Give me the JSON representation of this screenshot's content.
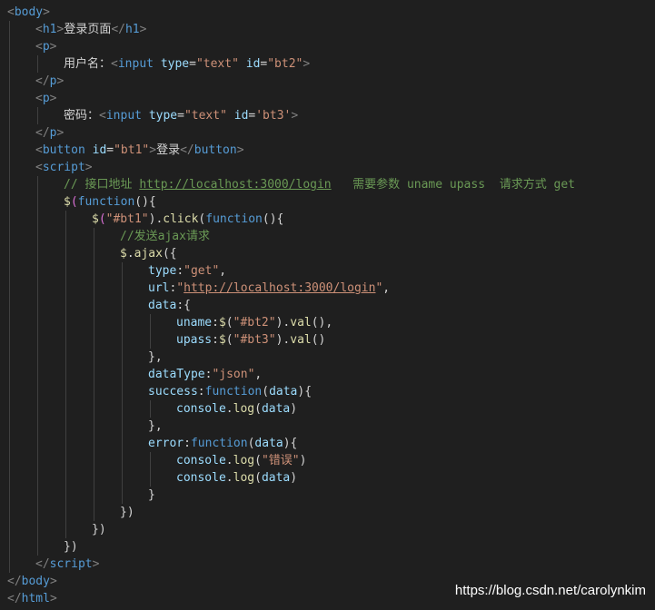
{
  "colors": {
    "background": "#1f1f1f",
    "tag_bracket": "#808080",
    "tag_name": "#569cd6",
    "attribute": "#9cdcfe",
    "string": "#ce9178",
    "comment": "#6a9955",
    "function": "#dcdcaa",
    "text": "#d4d4d4"
  },
  "lines": [
    {
      "indent": 0,
      "tokens": [
        [
          "&lt;",
          "gray"
        ],
        [
          "body",
          "tag"
        ],
        [
          "&gt;",
          "gray"
        ]
      ]
    },
    {
      "indent": 1,
      "tokens": [
        [
          "<",
          "gray"
        ],
        [
          "h1",
          "tag"
        ],
        [
          ">",
          "gray"
        ],
        [
          "登录页面",
          "text"
        ],
        [
          "</",
          "gray"
        ],
        [
          "h1",
          "tag"
        ],
        [
          ">",
          "gray"
        ]
      ]
    },
    {
      "indent": 1,
      "tokens": [
        [
          "<",
          "gray"
        ],
        [
          "p",
          "tag"
        ],
        [
          ">",
          "gray"
        ]
      ]
    },
    {
      "indent": 2,
      "tokens": [
        [
          "用户名：",
          "text"
        ],
        [
          "<",
          "gray"
        ],
        [
          "input",
          "tag"
        ],
        [
          " ",
          "text"
        ],
        [
          "type",
          "attr"
        ],
        [
          "=",
          "text"
        ],
        [
          "\"text\"",
          "str"
        ],
        [
          " ",
          "text"
        ],
        [
          "id",
          "attr"
        ],
        [
          "=",
          "text"
        ],
        [
          "\"bt2\"",
          "str"
        ],
        [
          ">",
          "gray"
        ]
      ]
    },
    {
      "indent": 1,
      "tokens": [
        [
          "</",
          "gray"
        ],
        [
          "p",
          "tag"
        ],
        [
          ">",
          "gray"
        ]
      ]
    },
    {
      "indent": 1,
      "tokens": [
        [
          "<",
          "gray"
        ],
        [
          "p",
          "tag"
        ],
        [
          ">",
          "gray"
        ]
      ]
    },
    {
      "indent": 2,
      "tokens": [
        [
          "密码：",
          "text"
        ],
        [
          "<",
          "gray"
        ],
        [
          "input",
          "tag"
        ],
        [
          " ",
          "text"
        ],
        [
          "type",
          "attr"
        ],
        [
          "=",
          "text"
        ],
        [
          "\"text\"",
          "str"
        ],
        [
          " ",
          "text"
        ],
        [
          "id",
          "attr"
        ],
        [
          "=",
          "text"
        ],
        [
          "'bt3'",
          "str"
        ],
        [
          ">",
          "gray"
        ]
      ]
    },
    {
      "indent": 1,
      "tokens": [
        [
          "</",
          "gray"
        ],
        [
          "p",
          "tag"
        ],
        [
          ">",
          "gray"
        ]
      ]
    },
    {
      "indent": 1,
      "tokens": [
        [
          "<",
          "gray"
        ],
        [
          "button",
          "tag"
        ],
        [
          " ",
          "text"
        ],
        [
          "id",
          "attr"
        ],
        [
          "=",
          "text"
        ],
        [
          "\"bt1\"",
          "str"
        ],
        [
          ">",
          "gray"
        ],
        [
          "登录",
          "text"
        ],
        [
          "</",
          "gray"
        ],
        [
          "button",
          "tag"
        ],
        [
          ">",
          "gray"
        ]
      ]
    },
    {
      "indent": 1,
      "tokens": [
        [
          "<",
          "gray"
        ],
        [
          "script",
          "tag"
        ],
        [
          ">",
          "gray"
        ]
      ]
    },
    {
      "indent": 2,
      "tokens": [
        [
          "// 接口地址 ",
          "comment"
        ],
        [
          "http://localhost:3000/login",
          "link"
        ],
        [
          "   需要参数 uname upass  请求方式 get",
          "comment"
        ]
      ]
    },
    {
      "indent": 2,
      "tokens": [
        [
          "$",
          "ident"
        ],
        [
          "(",
          "paren"
        ],
        [
          "function",
          "kw"
        ],
        [
          "(){",
          "punct"
        ]
      ]
    },
    {
      "indent": 3,
      "tokens": [
        [
          "$",
          "ident"
        ],
        [
          "(",
          "paren"
        ],
        [
          "\"#bt1\"",
          "str"
        ],
        [
          ").",
          "punct"
        ],
        [
          "click",
          "fn"
        ],
        [
          "(",
          "punct"
        ],
        [
          "function",
          "kw"
        ],
        [
          "(){",
          "punct"
        ]
      ]
    },
    {
      "indent": 4,
      "tokens": [
        [
          "//发送ajax请求",
          "comment"
        ]
      ]
    },
    {
      "indent": 4,
      "tokens": [
        [
          "$",
          "ident"
        ],
        [
          ".",
          "punct"
        ],
        [
          "ajax",
          "fn"
        ],
        [
          "({",
          "punct"
        ]
      ]
    },
    {
      "indent": 5,
      "tokens": [
        [
          "type",
          "var"
        ],
        [
          ":",
          "punct"
        ],
        [
          "\"get\"",
          "str"
        ],
        [
          ",",
          "punct"
        ]
      ]
    },
    {
      "indent": 5,
      "tokens": [
        [
          "url",
          "var"
        ],
        [
          ":",
          "punct"
        ],
        [
          "\"",
          "str"
        ],
        [
          "http://localhost:3000/login",
          "strlink"
        ],
        [
          "\"",
          "str"
        ],
        [
          ",",
          "punct"
        ]
      ]
    },
    {
      "indent": 5,
      "tokens": [
        [
          "data",
          "var"
        ],
        [
          ":{",
          "punct"
        ]
      ]
    },
    {
      "indent": 6,
      "tokens": [
        [
          "uname",
          "var"
        ],
        [
          ":",
          "punct"
        ],
        [
          "$",
          "ident"
        ],
        [
          "(",
          "punct"
        ],
        [
          "\"#bt2\"",
          "str"
        ],
        [
          ").",
          "punct"
        ],
        [
          "val",
          "fn"
        ],
        [
          "(),",
          "punct"
        ]
      ]
    },
    {
      "indent": 6,
      "tokens": [
        [
          "upass",
          "var"
        ],
        [
          ":",
          "punct"
        ],
        [
          "$",
          "ident"
        ],
        [
          "(",
          "punct"
        ],
        [
          "\"#bt3\"",
          "str"
        ],
        [
          ").",
          "punct"
        ],
        [
          "val",
          "fn"
        ],
        [
          "()",
          "punct"
        ]
      ]
    },
    {
      "indent": 5,
      "tokens": [
        [
          "},",
          "punct"
        ]
      ]
    },
    {
      "indent": 5,
      "tokens": [
        [
          "dataType",
          "var"
        ],
        [
          ":",
          "punct"
        ],
        [
          "\"json\"",
          "str"
        ],
        [
          ",",
          "punct"
        ]
      ]
    },
    {
      "indent": 5,
      "tokens": [
        [
          "success",
          "var"
        ],
        [
          ":",
          "punct"
        ],
        [
          "function",
          "kw"
        ],
        [
          "(",
          "punct"
        ],
        [
          "data",
          "var"
        ],
        [
          "){",
          "punct"
        ]
      ]
    },
    {
      "indent": 6,
      "tokens": [
        [
          "console",
          "var"
        ],
        [
          ".",
          "punct"
        ],
        [
          "log",
          "fn"
        ],
        [
          "(",
          "punct"
        ],
        [
          "data",
          "var"
        ],
        [
          ")",
          "punct"
        ]
      ]
    },
    {
      "indent": 5,
      "tokens": [
        [
          "},",
          "punct"
        ]
      ]
    },
    {
      "indent": 5,
      "tokens": [
        [
          "error",
          "var"
        ],
        [
          ":",
          "punct"
        ],
        [
          "function",
          "kw"
        ],
        [
          "(",
          "punct"
        ],
        [
          "data",
          "var"
        ],
        [
          "){",
          "punct"
        ]
      ]
    },
    {
      "indent": 6,
      "tokens": [
        [
          "console",
          "var"
        ],
        [
          ".",
          "punct"
        ],
        [
          "log",
          "fn"
        ],
        [
          "(",
          "punct"
        ],
        [
          "\"错误\"",
          "str"
        ],
        [
          ")",
          "punct"
        ]
      ]
    },
    {
      "indent": 6,
      "tokens": [
        [
          "console",
          "var"
        ],
        [
          ".",
          "punct"
        ],
        [
          "log",
          "fn"
        ],
        [
          "(",
          "punct"
        ],
        [
          "data",
          "var"
        ],
        [
          ")",
          "punct"
        ]
      ]
    },
    {
      "indent": 5,
      "tokens": [
        [
          "}",
          "punct"
        ]
      ]
    },
    {
      "indent": 4,
      "tokens": [
        [
          "})",
          "punct"
        ]
      ]
    },
    {
      "indent": 3,
      "tokens": [
        [
          "})",
          "punct"
        ]
      ]
    },
    {
      "indent": 2,
      "tokens": [
        [
          "})",
          "punct"
        ]
      ]
    },
    {
      "indent": 1,
      "tokens": [
        [
          "</",
          "gray"
        ],
        [
          "script",
          "tag"
        ],
        [
          ">",
          "gray"
        ]
      ]
    },
    {
      "indent": 0,
      "tokens": [
        [
          "</",
          "gray"
        ],
        [
          "body",
          "tag"
        ],
        [
          ">",
          "gray"
        ]
      ]
    },
    {
      "indent": 0,
      "tokens": [
        [
          "</",
          "gray"
        ],
        [
          "html",
          "tag"
        ],
        [
          ">",
          "gray"
        ]
      ]
    }
  ],
  "watermark": "https://blog.csdn.net/carolynkim"
}
